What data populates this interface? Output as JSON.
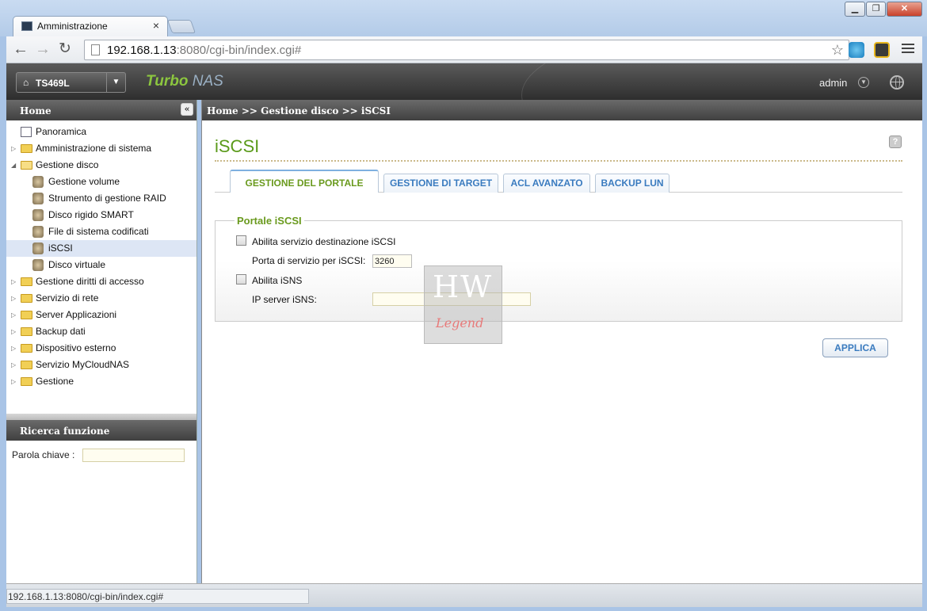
{
  "browser": {
    "tab_title": "Amministrazione",
    "tab_close": "×",
    "url_host": "192.168.1.13",
    "url_rest": ":8080/cgi-bin/index.cgi#",
    "status_url": "192.168.1.13:8080/cgi-bin/index.cgi#",
    "window_buttons": {
      "min": "▁",
      "max": "❐",
      "close": "✕"
    }
  },
  "header": {
    "device": "TS469L",
    "brand_turbo": "Turbo",
    "brand_nas": "NAS",
    "user": "admin"
  },
  "sidebar": {
    "title": "Home",
    "items": [
      {
        "label": "Panoramica"
      },
      {
        "label": "Amministrazione di sistema"
      },
      {
        "label": "Gestione disco"
      },
      {
        "label": "Gestione volume"
      },
      {
        "label": "Strumento di gestione RAID"
      },
      {
        "label": "Disco rigido SMART"
      },
      {
        "label": "File di sistema codificati"
      },
      {
        "label": "iSCSI"
      },
      {
        "label": "Disco virtuale"
      },
      {
        "label": "Gestione diritti di accesso"
      },
      {
        "label": "Servizio di rete"
      },
      {
        "label": "Server Applicazioni"
      },
      {
        "label": "Backup dati"
      },
      {
        "label": "Dispositivo esterno"
      },
      {
        "label": "Servizio MyCloudNAS"
      },
      {
        "label": "Gestione"
      }
    ],
    "search_title": "Ricerca funzione",
    "keyword_label": "Parola chiave :"
  },
  "main": {
    "breadcrumb": "Home >> Gestione disco >> iSCSI",
    "title": "iSCSI",
    "tabs": [
      {
        "label": "GESTIONE DEL PORTALE"
      },
      {
        "label": "GESTIONE DI TARGET"
      },
      {
        "label": "ACL AVANZATO"
      },
      {
        "label": "BACKUP LUN"
      }
    ],
    "portal": {
      "legend": "Portale iSCSI",
      "enable_target_label": "Abilita servizio destinazione iSCSI",
      "port_label": "Porta di servizio per iSCSI:",
      "port_value": "3260",
      "enable_isns_label": "Abilita iSNS",
      "isns_ip_label": "IP server iSNS:",
      "isns_ip_value": ""
    },
    "watermark_top": "HW",
    "watermark_bottom": "Legend",
    "apply_label": "APPLICA"
  }
}
